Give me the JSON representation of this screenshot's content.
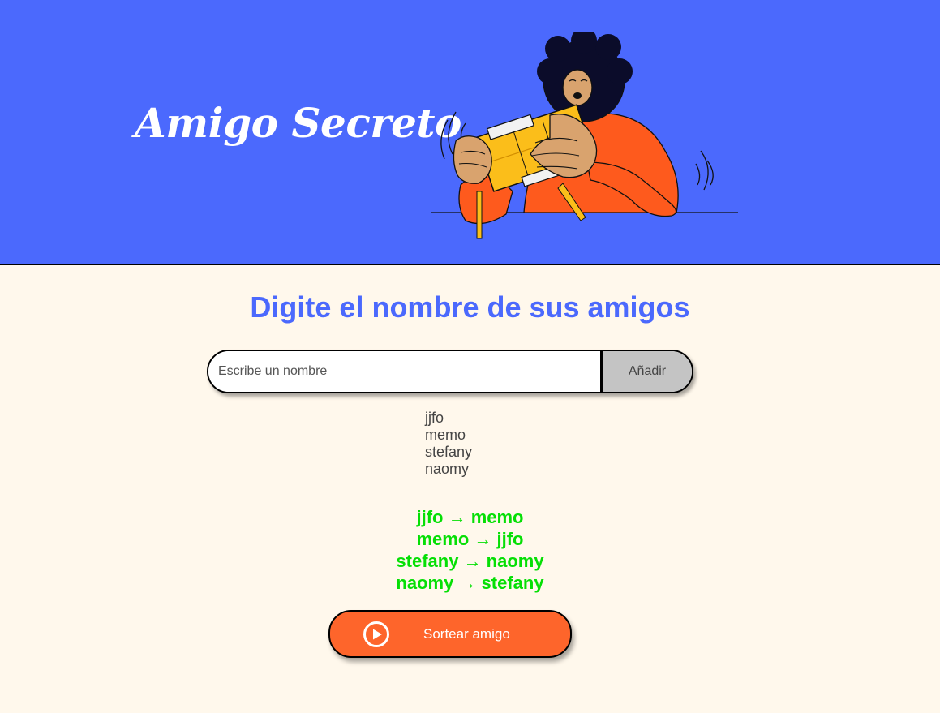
{
  "header": {
    "title": "Amigo Secreto",
    "illustration": "person-holding-gift-box-illustration",
    "background_color": "#4B69FD"
  },
  "main": {
    "heading": "Digite el nombre de sus amigos",
    "name_input": {
      "placeholder": "Escribe un nombre",
      "value": ""
    },
    "add_button_label": "Añadir",
    "friends": [
      "jjfo",
      "memo",
      "stefany",
      "naomy"
    ],
    "results": [
      "jjfo → memo",
      "memo → jjfo",
      "stefany → naomy",
      "naomy → stefany"
    ],
    "draw_button": {
      "label": "Sortear amigo",
      "icon": "play-circle-icon"
    }
  },
  "colors": {
    "accent": "#4B69FD",
    "page_background": "#FFF8EC",
    "result_text": "#05DF05",
    "draw_button": "#FE652B",
    "add_button": "#C4C4C4"
  }
}
